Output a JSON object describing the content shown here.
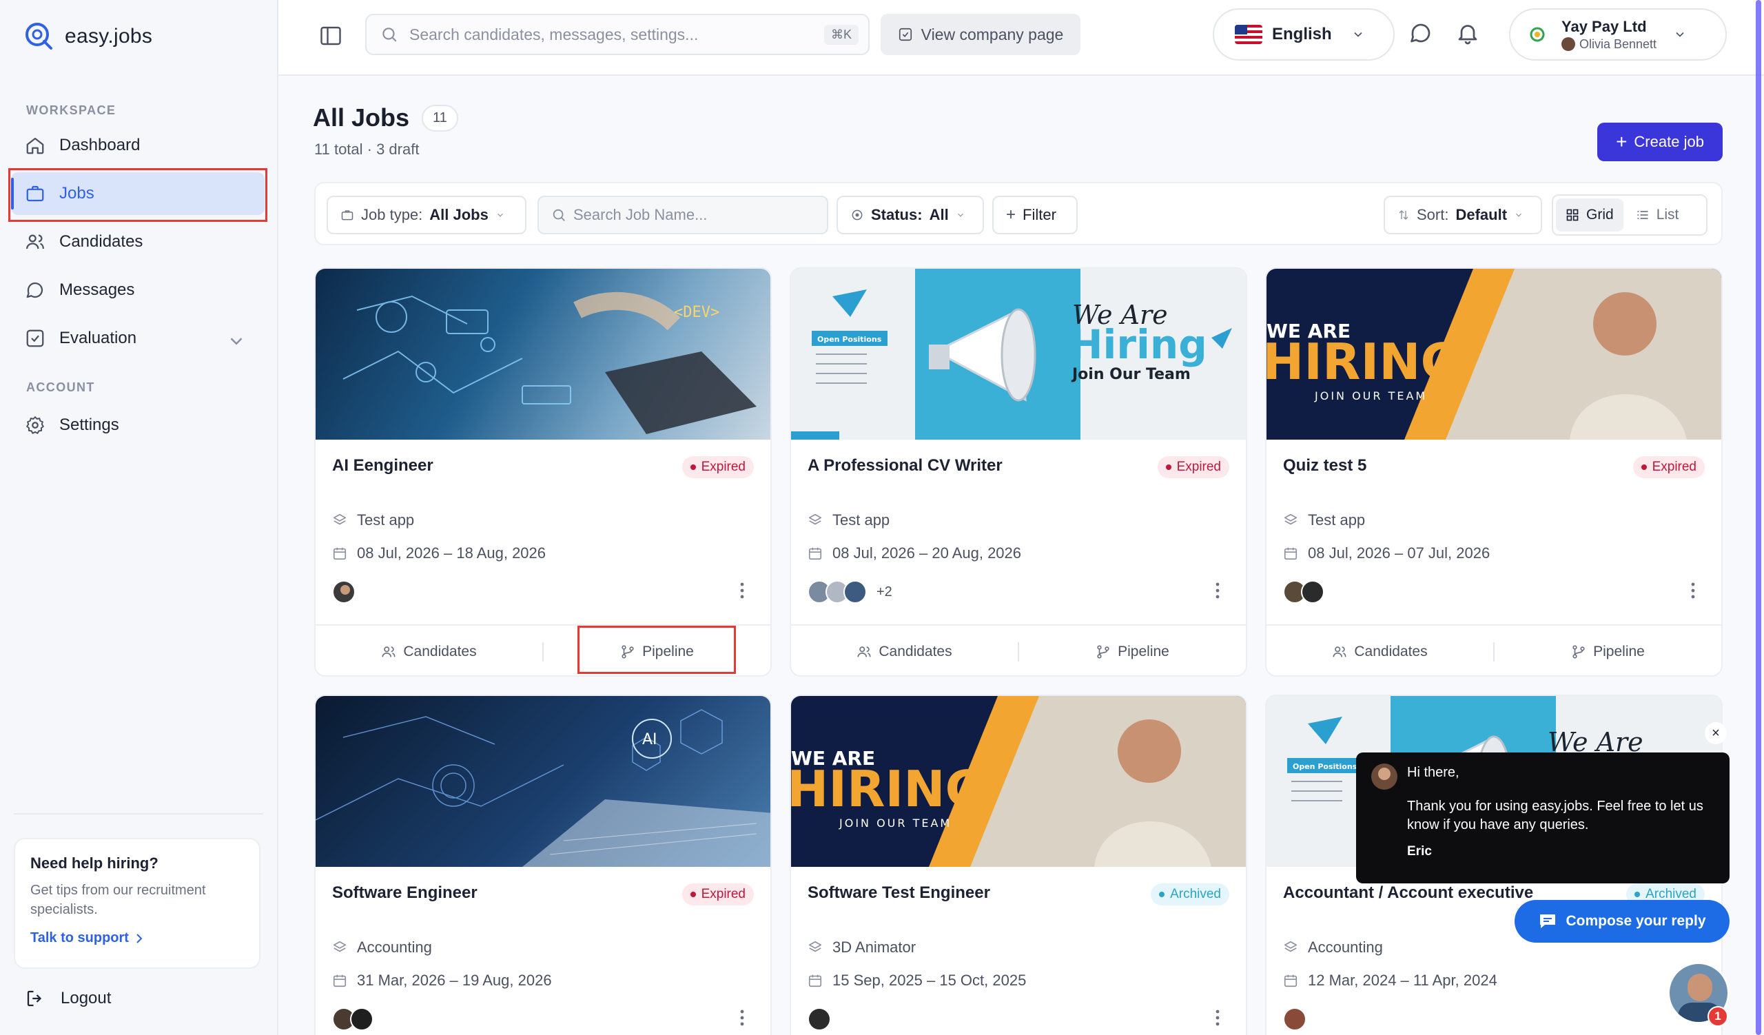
{
  "app": {
    "name": "easy.jobs"
  },
  "sidebar": {
    "workspace_label": "WORKSPACE",
    "account_label": "ACCOUNT",
    "items": [
      {
        "label": "Dashboard"
      },
      {
        "label": "Jobs"
      },
      {
        "label": "Candidates"
      },
      {
        "label": "Messages"
      },
      {
        "label": "Evaluation"
      }
    ],
    "settings_label": "Settings",
    "help": {
      "title": "Need help hiring?",
      "text": "Get tips from our recruitment specialists.",
      "link": "Talk to support"
    },
    "logout_label": "Logout"
  },
  "topbar": {
    "search_placeholder": "Search candidates, messages, settings...",
    "shortcut": "⌘K",
    "view_company_label": "View company page",
    "language": "English",
    "company_name": "Yay Pay Ltd",
    "user_name": "Olivia Bennett"
  },
  "page": {
    "title": "All Jobs",
    "count": "11",
    "subtitle": "11 total · 3 draft",
    "create_label": "Create job"
  },
  "filters": {
    "job_type_label": "Job type:",
    "job_type_value": "All Jobs",
    "search_placeholder": "Search Job Name...",
    "status_label": "Status:",
    "status_value": "All",
    "filter_label": "Filter",
    "sort_label": "Sort:",
    "sort_value": "Default",
    "grid_label": "Grid",
    "list_label": "List"
  },
  "card_actions": {
    "candidates": "Candidates",
    "pipeline": "Pipeline"
  },
  "jobs": [
    {
      "title": "AI Eengineer",
      "status": "Expired",
      "app": "Test app",
      "dates": "08 Jul, 2026 – 18 Aug, 2026",
      "more": ""
    },
    {
      "title": "A Professional CV Writer",
      "status": "Expired",
      "app": "Test app",
      "dates": "08 Jul, 2026 – 20 Aug, 2026",
      "more": "+2"
    },
    {
      "title": "Quiz test 5",
      "status": "Expired",
      "app": "Test app",
      "dates": "08 Jul, 2026 – 07 Jul, 2026",
      "more": ""
    },
    {
      "title": "Software Engineer",
      "status": "Expired",
      "app": "Accounting",
      "dates": "31 Mar, 2026 – 19 Aug, 2026",
      "more": ""
    },
    {
      "title": "Software Test Engineer",
      "status": "Archived",
      "app": "3D Animator",
      "dates": "15 Sep, 2025 – 15 Oct, 2025",
      "more": ""
    },
    {
      "title": "Accountant / Account executive",
      "status": "Archived",
      "app": "Accounting",
      "dates": "12 Mar, 2024 – 11 Apr, 2024",
      "more": ""
    }
  ],
  "banners": {
    "hiring_a": {
      "line1": "We Are",
      "line2": "Hiring",
      "line3": "Join Our Team",
      "open_positions": "Open Positions"
    },
    "hiring_b": {
      "line1": "WE ARE",
      "line2": "HIRING",
      "line3": "JOIN OUR TEAM"
    },
    "ai_chip": "AI",
    "dev_tag": "<DEV>"
  },
  "chat": {
    "greeting": "Hi there,",
    "message": "Thank you for using easy.jobs. Feel free to let us know if you have any queries.",
    "signature": "Eric",
    "compose_label": "Compose your reply",
    "unread": "1"
  },
  "colors": {
    "primary": "#3b36d9",
    "accent": "#2f61e6",
    "expired": "#c0183a",
    "archived": "#2aa3c4"
  }
}
